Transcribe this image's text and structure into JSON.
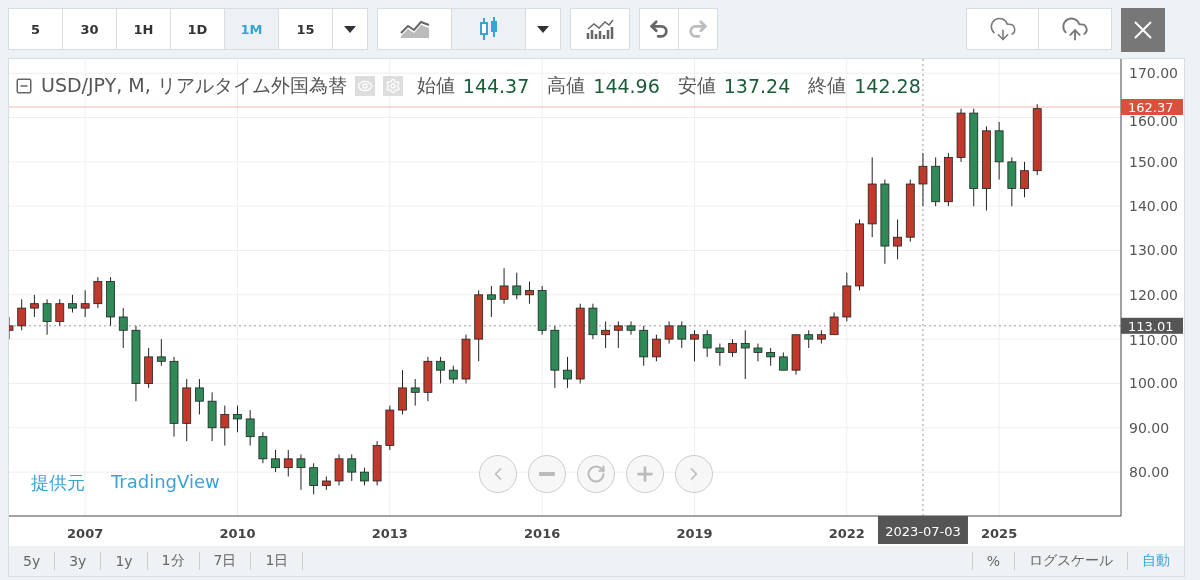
{
  "toolbar": {
    "intervals": [
      {
        "label": "5",
        "selected": false
      },
      {
        "label": "30",
        "selected": false
      },
      {
        "label": "1H",
        "selected": false
      },
      {
        "label": "1D",
        "selected": false
      },
      {
        "label": "1M",
        "selected": true
      },
      {
        "label": "15",
        "selected": false
      }
    ],
    "chart_types": [
      {
        "kind": "line",
        "selected": false
      },
      {
        "kind": "candles",
        "selected": true
      }
    ],
    "history": [
      {
        "kind": "undo",
        "disabled": false
      },
      {
        "kind": "redo",
        "disabled": true
      }
    ]
  },
  "legend": {
    "title": "USD/JPY, M, リアルタイム外国為替",
    "ohlc": [
      {
        "label": "始値",
        "value": "144.37"
      },
      {
        "label": "高値",
        "value": "144.96"
      },
      {
        "label": "安値",
        "value": "137.24"
      },
      {
        "label": "終値",
        "value": "142.28"
      }
    ]
  },
  "chart": {
    "chart_data": {
      "type": "candlestick",
      "grid": true,
      "x": [
        2005.5,
        2005.75,
        2006,
        2006.25,
        2006.5,
        2006.75,
        2007,
        2007.25,
        2007.5,
        2007.75,
        2008,
        2008.25,
        2008.5,
        2008.75,
        2009,
        2009.25,
        2009.5,
        2009.75,
        2010,
        2010.25,
        2010.5,
        2010.75,
        2011,
        2011.25,
        2011.5,
        2011.75,
        2012,
        2012.25,
        2012.5,
        2012.75,
        2013,
        2013.25,
        2013.5,
        2013.75,
        2014,
        2014.25,
        2014.5,
        2014.75,
        2015,
        2015.25,
        2015.5,
        2015.75,
        2016,
        2016.25,
        2016.5,
        2016.75,
        2017,
        2017.25,
        2017.5,
        2017.75,
        2018,
        2018.25,
        2018.5,
        2018.75,
        2019,
        2019.25,
        2019.5,
        2019.75,
        2020,
        2020.25,
        2020.5,
        2020.75,
        2021,
        2021.25,
        2021.5,
        2021.75,
        2022,
        2022.25,
        2022.5,
        2022.75,
        2023,
        2023.25,
        2023.5,
        2023.75,
        2024,
        2024.25,
        2024.5,
        2024.75,
        2025,
        2025.25,
        2025.5,
        2025.75
      ],
      "ohlc": [
        [
          112,
          115,
          110,
          113
        ],
        [
          113,
          119,
          112,
          117
        ],
        [
          117,
          120,
          115,
          118
        ],
        [
          118,
          119,
          111,
          114
        ],
        [
          114,
          119,
          113,
          118
        ],
        [
          118,
          120,
          116,
          117
        ],
        [
          117,
          121,
          115,
          118
        ],
        [
          118,
          124,
          117,
          123
        ],
        [
          123,
          124,
          113,
          115
        ],
        [
          115,
          117,
          108,
          112
        ],
        [
          112,
          113,
          96,
          100
        ],
        [
          100,
          108,
          99,
          106
        ],
        [
          106,
          110,
          104,
          105
        ],
        [
          105,
          106,
          88,
          91
        ],
        [
          91,
          101,
          87,
          99
        ],
        [
          99,
          101,
          93,
          96
        ],
        [
          96,
          98,
          87,
          90
        ],
        [
          90,
          95,
          86,
          93
        ],
        [
          93,
          95,
          89,
          92
        ],
        [
          92,
          94,
          86,
          88
        ],
        [
          88,
          89,
          82,
          83
        ],
        [
          83,
          85,
          80,
          81
        ],
        [
          81,
          85,
          79,
          83
        ],
        [
          83,
          84,
          76,
          81
        ],
        [
          81,
          82,
          75,
          77
        ],
        [
          77,
          79,
          76,
          78
        ],
        [
          78,
          84,
          77,
          83
        ],
        [
          83,
          84,
          78,
          80
        ],
        [
          80,
          81,
          77,
          78
        ],
        [
          78,
          87,
          77,
          86
        ],
        [
          86,
          95,
          85,
          94
        ],
        [
          94,
          103,
          93,
          99
        ],
        [
          99,
          101,
          95,
          98
        ],
        [
          98,
          106,
          96,
          105
        ],
        [
          105,
          106,
          100,
          103
        ],
        [
          103,
          104,
          100,
          101
        ],
        [
          101,
          111,
          100,
          110
        ],
        [
          110,
          121,
          105,
          120
        ],
        [
          120,
          122,
          115,
          119
        ],
        [
          119,
          126,
          118,
          122
        ],
        [
          122,
          125,
          119,
          120
        ],
        [
          120,
          123,
          118,
          121
        ],
        [
          121,
          122,
          111,
          112
        ],
        [
          112,
          113,
          99,
          103
        ],
        [
          103,
          106,
          99,
          101
        ],
        [
          101,
          118,
          100,
          117
        ],
        [
          117,
          118,
          110,
          111
        ],
        [
          111,
          114,
          108,
          112
        ],
        [
          112,
          114,
          108,
          113
        ],
        [
          113,
          114,
          111,
          112
        ],
        [
          112,
          113,
          104,
          106
        ],
        [
          106,
          111,
          105,
          110
        ],
        [
          110,
          114,
          109,
          113
        ],
        [
          113,
          114,
          108,
          110
        ],
        [
          110,
          112,
          105,
          111
        ],
        [
          111,
          112,
          106,
          108
        ],
        [
          108,
          109,
          104,
          107
        ],
        [
          107,
          110,
          106,
          109
        ],
        [
          109,
          112,
          101,
          108
        ],
        [
          108,
          109,
          105,
          107
        ],
        [
          107,
          108,
          104,
          106
        ],
        [
          106,
          107,
          103,
          103
        ],
        [
          103,
          111,
          102,
          111
        ],
        [
          111,
          112,
          108,
          110
        ],
        [
          110,
          112,
          109,
          111
        ],
        [
          111,
          116,
          111,
          115
        ],
        [
          115,
          125,
          114,
          122
        ],
        [
          122,
          137,
          121,
          136
        ],
        [
          136,
          151,
          133,
          145
        ],
        [
          145,
          146,
          127,
          131
        ],
        [
          131,
          137,
          128,
          133
        ],
        [
          133,
          146,
          132,
          145
        ],
        [
          145,
          152,
          140,
          149
        ],
        [
          149,
          151,
          140,
          141
        ],
        [
          141,
          152,
          140,
          151
        ],
        [
          151,
          162,
          150,
          161
        ],
        [
          161,
          162,
          140,
          144
        ],
        [
          144,
          158,
          139,
          157
        ],
        [
          157,
          159,
          146,
          150
        ],
        [
          150,
          151,
          140,
          144
        ],
        [
          144,
          150,
          142,
          148
        ],
        [
          148,
          163,
          147,
          162
        ]
      ],
      "xlim": [
        2005.5,
        2027.4
      ],
      "ylim": [
        70.1,
        173.2
      ],
      "xticks": [
        2007,
        2010,
        2013,
        2016,
        2019,
        2022,
        2025
      ],
      "yticks": [
        {
          "value": 80,
          "label": "80.00"
        },
        {
          "value": 90,
          "label": "90.00"
        },
        {
          "value": 100,
          "label": "100.00"
        },
        {
          "value": 110,
          "label": "110.00"
        },
        {
          "value": 120,
          "label": "120.00"
        },
        {
          "value": 130,
          "label": "130.00"
        },
        {
          "value": 140,
          "label": "140.00"
        },
        {
          "value": 150,
          "label": "150.00"
        },
        {
          "value": 160,
          "label": "160.00"
        },
        {
          "value": 170,
          "label": "170.00"
        }
      ],
      "ref_lines": [
        {
          "axis": "y",
          "value": 162.37,
          "label": "162.37",
          "color": "#d9513c"
        },
        {
          "axis": "y",
          "value": 113.01,
          "label": "113.01",
          "color": "#555555"
        },
        {
          "axis": "x",
          "value": 2023.5,
          "label": "2023-07-03",
          "color": "#555555"
        }
      ]
    },
    "attribution": {
      "prefix": "提供元",
      "link": "TradingView"
    }
  },
  "bottom_bar": {
    "ranges": [
      {
        "label": "5y"
      },
      {
        "label": "3y"
      },
      {
        "label": "1y"
      },
      {
        "label": "1分"
      },
      {
        "label": "7日"
      },
      {
        "label": "1日"
      }
    ],
    "options": [
      {
        "label": "%",
        "selected": false
      },
      {
        "label": "ログスケール",
        "selected": false
      },
      {
        "label": "自動",
        "selected": true
      }
    ]
  }
}
